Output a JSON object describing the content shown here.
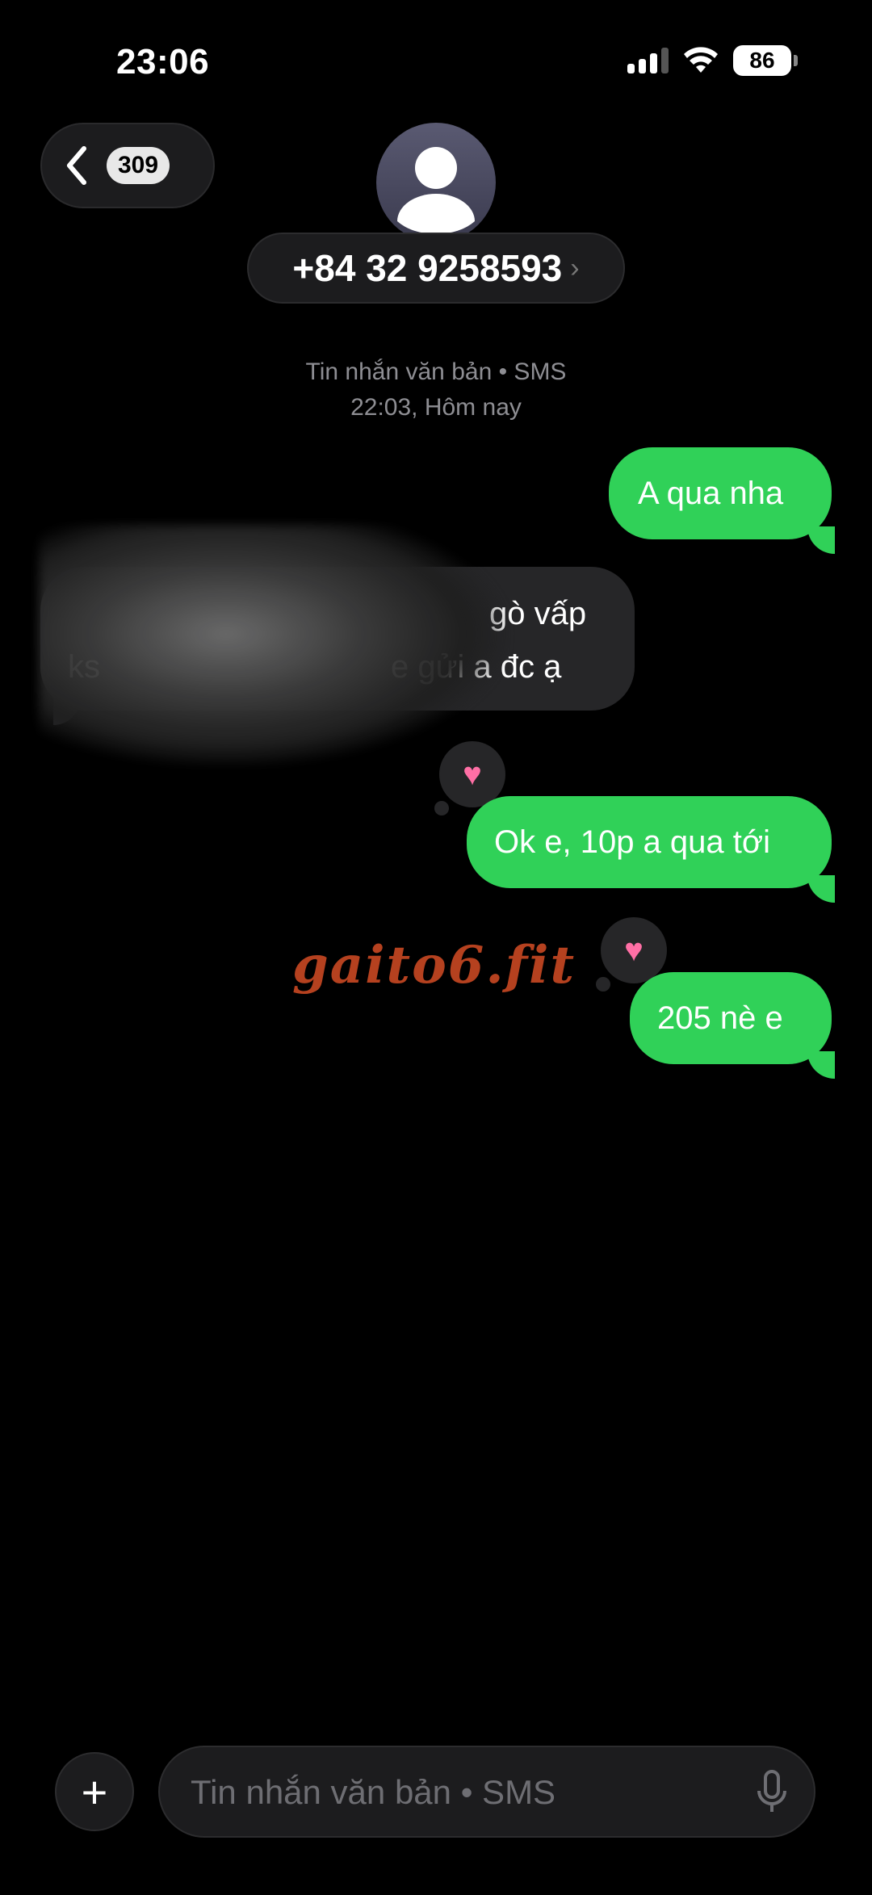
{
  "status_bar": {
    "time": "23:06",
    "battery": "86"
  },
  "header": {
    "back_count": "309",
    "contact": "+84 32 9258593",
    "chevron": "›"
  },
  "thread": {
    "meta_type": "Tin nhắn văn bản • SMS",
    "meta_time": "22:03, Hôm nay"
  },
  "messages": [
    {
      "direction": "outgoing",
      "text": "A qua nha"
    },
    {
      "direction": "incoming",
      "line1": "gò vấp",
      "line2": "ks",
      "line3": "e gửi a đc ạ"
    },
    {
      "direction": "outgoing",
      "text": "Ok e, 10p a qua tới",
      "reaction": "♥"
    },
    {
      "direction": "outgoing",
      "text": "205 nè e",
      "reaction": "♥"
    }
  ],
  "watermark": "gaito6.fit",
  "composer": {
    "placeholder": "Tin nhắn văn bản • SMS",
    "plus": "+"
  },
  "colors": {
    "outgoing_bubble": "#30d158",
    "incoming_bubble": "#262628",
    "background": "#000000",
    "watermark": "#b5411f"
  }
}
